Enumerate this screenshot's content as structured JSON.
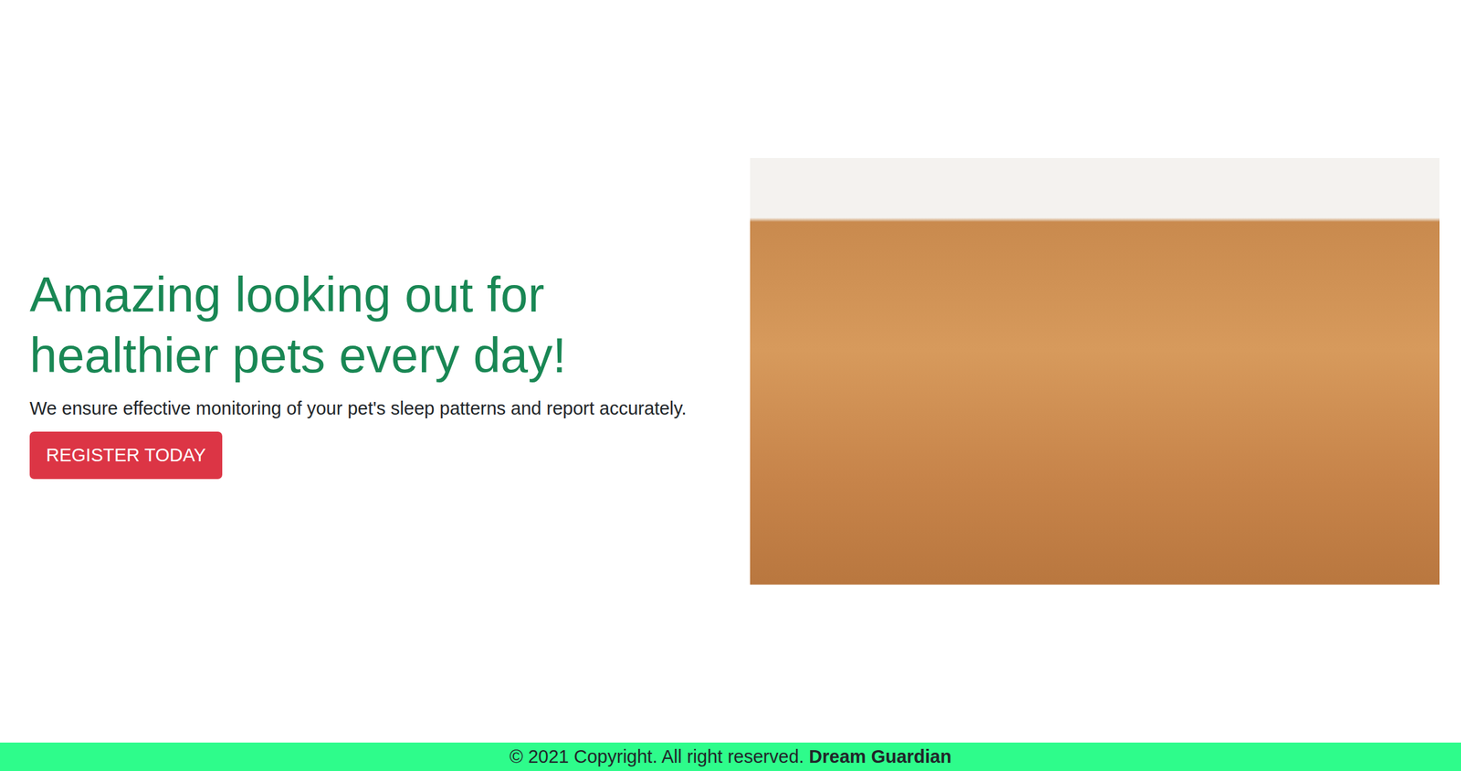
{
  "hero": {
    "title": "Amazing looking out for healthier pets every day!",
    "subtitle": "We ensure effective monitoring of your pet's sleep patterns and report accurately.",
    "button": "REGISTER TODAY"
  },
  "footer": {
    "text": "© 2021 Copyright. All right reserved.",
    "brand": "Dream Guardian"
  }
}
